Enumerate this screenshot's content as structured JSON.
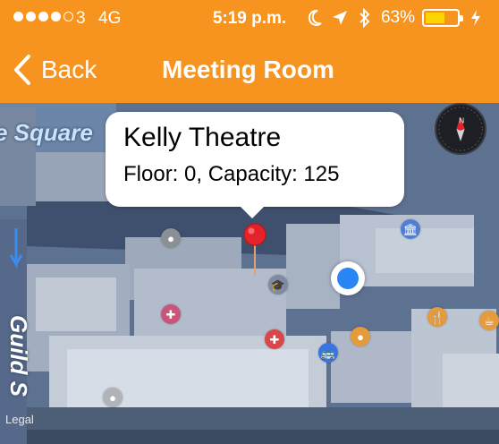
{
  "status_bar": {
    "carrier": "3",
    "network": "4G",
    "time": "5:19 p.m.",
    "battery_percent": "63%",
    "battery_level": 0.63,
    "signal_bars_filled": 4,
    "signal_bars_total": 5,
    "icons": [
      "moon-icon",
      "location-arrow-icon",
      "bluetooth-icon",
      "charging-bolt-icon"
    ]
  },
  "nav": {
    "back_label": "Back",
    "title": "Meeting Room"
  },
  "map": {
    "street_top": "e Square",
    "street_left": "Guild S",
    "legal": "Legal",
    "callout": {
      "title": "Kelly Theatre",
      "subtitle": "Floor: 0, Capacity: 125"
    },
    "pois": [
      {
        "name": "museum-icon",
        "color": "#4e7ed6"
      },
      {
        "name": "graduation-cap-icon",
        "color": "#7f8aa3"
      },
      {
        "name": "tooth-icon",
        "color": "#c8557a"
      },
      {
        "name": "restaurant-icon",
        "color": "#e59a3d"
      },
      {
        "name": "cafe-icon",
        "color": "#e59a3d"
      },
      {
        "name": "bus-icon",
        "color": "#3a74e0"
      },
      {
        "name": "pharmacy-icon",
        "color": "#d94848"
      },
      {
        "name": "place-icon",
        "color": "#8b8f96"
      },
      {
        "name": "point-icon",
        "color": "#b0b3b8"
      }
    ]
  },
  "colors": {
    "header": "#f7941f",
    "pin": "#e5222a",
    "user_location": "#2a86f5"
  }
}
